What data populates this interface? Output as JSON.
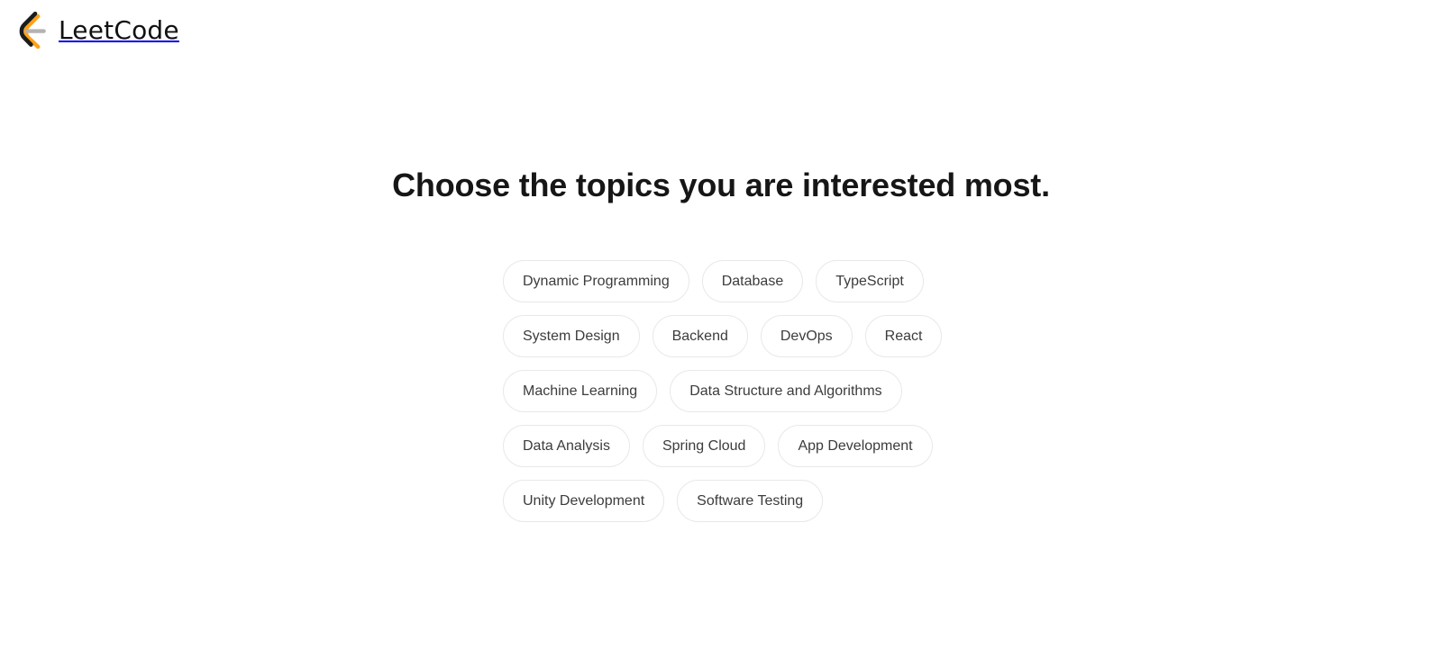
{
  "brand": {
    "name": "LeetCode",
    "logo_icon": "leetcode-logo-icon",
    "colors": {
      "mark_black": "#1c1c1c",
      "mark_orange": "#ffa116",
      "mark_gray": "#b3b3b3",
      "wordmark": "#111111"
    }
  },
  "main": {
    "headline": "Choose the topics you are interested most.",
    "topics": [
      {
        "label": "Dynamic Programming",
        "selected": false
      },
      {
        "label": "Database",
        "selected": false
      },
      {
        "label": "TypeScript",
        "selected": false
      },
      {
        "label": "System Design",
        "selected": false
      },
      {
        "label": "Backend",
        "selected": false
      },
      {
        "label": "DevOps",
        "selected": false
      },
      {
        "label": "React",
        "selected": false
      },
      {
        "label": "Machine Learning",
        "selected": false
      },
      {
        "label": "Data Structure and Algorithms",
        "selected": false
      },
      {
        "label": "Data Analysis",
        "selected": false
      },
      {
        "label": "Spring Cloud",
        "selected": false
      },
      {
        "label": "App Development",
        "selected": false
      },
      {
        "label": "Unity Development",
        "selected": false
      },
      {
        "label": "Software Testing",
        "selected": false
      }
    ]
  },
  "theme": {
    "background": "#ffffff",
    "chip_border": "#e8e8e8",
    "chip_text": "#3c3c3c",
    "headline_color": "#161616"
  }
}
